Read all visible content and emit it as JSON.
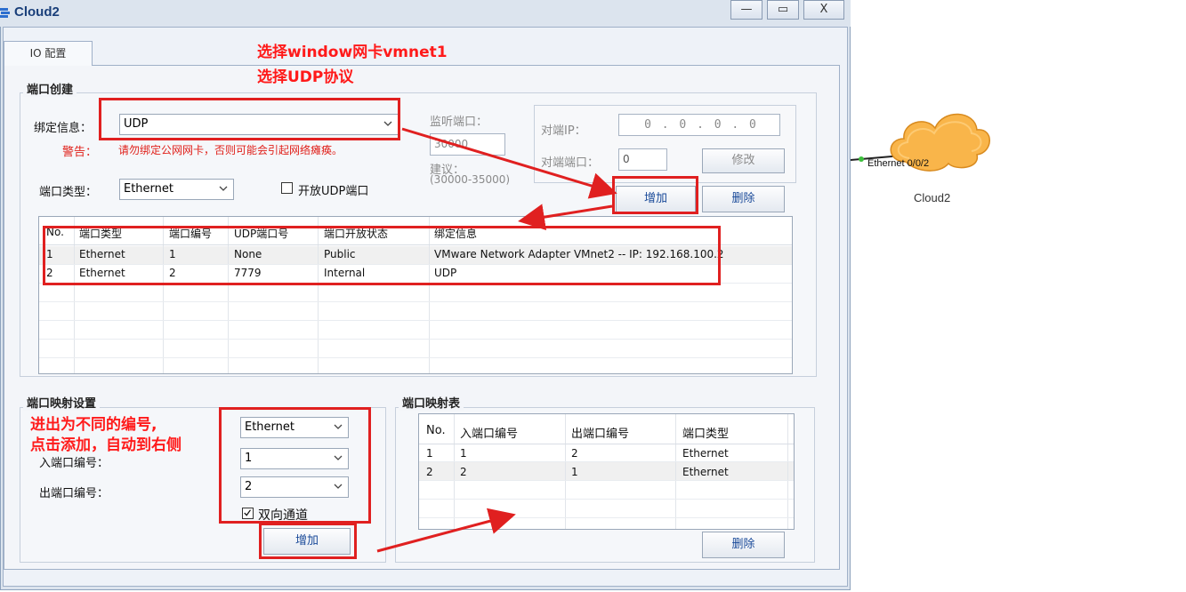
{
  "window": {
    "title": "Cloud2",
    "buttons": {
      "minimize": "—",
      "maximize": "▭",
      "close": "X"
    }
  },
  "tab": {
    "label": "IO 配置"
  },
  "port_create": {
    "group_title": "端口创建",
    "bind_label": "绑定信息：",
    "bind_value": "UDP",
    "warning_label": "警告：",
    "warning_text": "请勿绑定公网网卡，否则可能会引起网络瘫痪。",
    "port_type_label": "端口类型：",
    "port_type_value": "Ethernet",
    "open_udp_label": "开放UDP端口",
    "listen_port_label": "监听端口：",
    "listen_port_value": "30000",
    "suggest_label": "建议：",
    "suggest_range": "(30000-35000)",
    "peer_ip_label": "对端IP：",
    "peer_ip_value": "0 . 0 . 0 . 0",
    "peer_port_label": "对端端口：",
    "peer_port_value": "0",
    "modify_button": "修改",
    "add_button": "增加",
    "delete_button": "删除",
    "table": {
      "headers": [
        "No.",
        "端口类型",
        "端口编号",
        "UDP端口号",
        "端口开放状态",
        "绑定信息"
      ],
      "rows": [
        [
          "1",
          "Ethernet",
          "1",
          "None",
          "Public",
          "VMware Network Adapter VMnet2 -- IP: 192.168.100.2"
        ],
        [
          "2",
          "Ethernet",
          "2",
          "7779",
          "Internal",
          "UDP"
        ]
      ]
    }
  },
  "port_mapping": {
    "group_title": "端口映射设置",
    "port_type_value": "Ethernet",
    "in_port_label": "入端口编号：",
    "in_port_value": "1",
    "out_port_label": "出端口编号：",
    "out_port_value": "2",
    "bidirectional_label": "双向通道",
    "add_button": "增加"
  },
  "mapping_table": {
    "group_title": "端口映射表",
    "headers": [
      "No.",
      "入端口编号",
      "出端口编号",
      "端口类型"
    ],
    "rows": [
      [
        "1",
        "1",
        "2",
        "Ethernet"
      ],
      [
        "2",
        "2",
        "1",
        "Ethernet"
      ]
    ],
    "delete_button": "删除"
  },
  "annotations": {
    "top_line1": "选择window网卡vmnet1",
    "top_line2": "选择UDP协议",
    "mapping_line1": "进出为不同的编号,",
    "mapping_line2": "点击添加，自动到右侧"
  },
  "topology": {
    "cloud_name": "Cloud2",
    "port_label": "Ethernet 0/0/2"
  },
  "colors": {
    "annotation_red": "#ff1a1a",
    "window_bg": "#dce4ee",
    "cloud_fill": "#f9b54a"
  }
}
